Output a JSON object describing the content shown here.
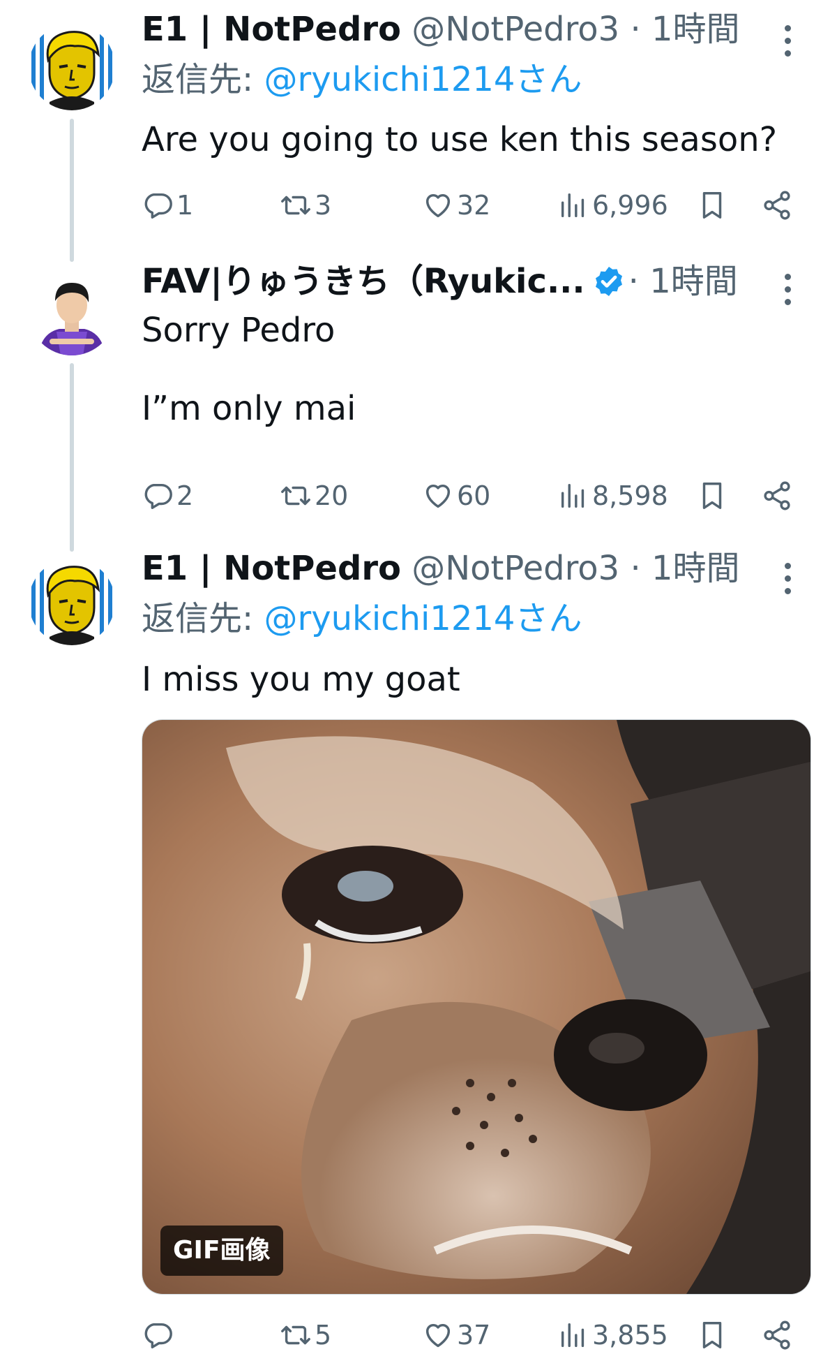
{
  "colors": {
    "link": "#1d9bf0",
    "secondary_text": "#536471",
    "primary_text": "#0f1419",
    "thread_line": "#cfd9de",
    "verified": "#1d9bf0"
  },
  "tweets": [
    {
      "name": "E1 | NotPedro",
      "handle": "@NotPedro3",
      "separator": "·",
      "time": "1時間",
      "reply_label": "返信先:",
      "reply_handle": "@ryukichi1214",
      "reply_suffix": "さん",
      "text": "Are you going to use ken this season?",
      "avatar_icon": "illustrated-avatar-icon",
      "replies": "1",
      "retweets": "3",
      "likes": "32",
      "views": "6,996"
    },
    {
      "name": "FAV|りゅうきち（Ryukic...",
      "verified": true,
      "separator": "·",
      "time": "1時間",
      "text": "Sorry Pedro\n\nI”m only mai",
      "avatar_icon": "player-photo-avatar-icon",
      "replies": "2",
      "retweets": "20",
      "likes": "60",
      "views": "8,598"
    },
    {
      "name": "E1 | NotPedro",
      "handle": "@NotPedro3",
      "separator": "·",
      "time": "1時間",
      "reply_label": "返信先:",
      "reply_handle": "@ryukichi1214",
      "reply_suffix": "さん",
      "text": "I miss you my goat",
      "avatar_icon": "illustrated-avatar-icon",
      "media_badge": "GIF画像",
      "replies": "",
      "retweets": "5",
      "likes": "37",
      "views": "3,855"
    }
  ]
}
